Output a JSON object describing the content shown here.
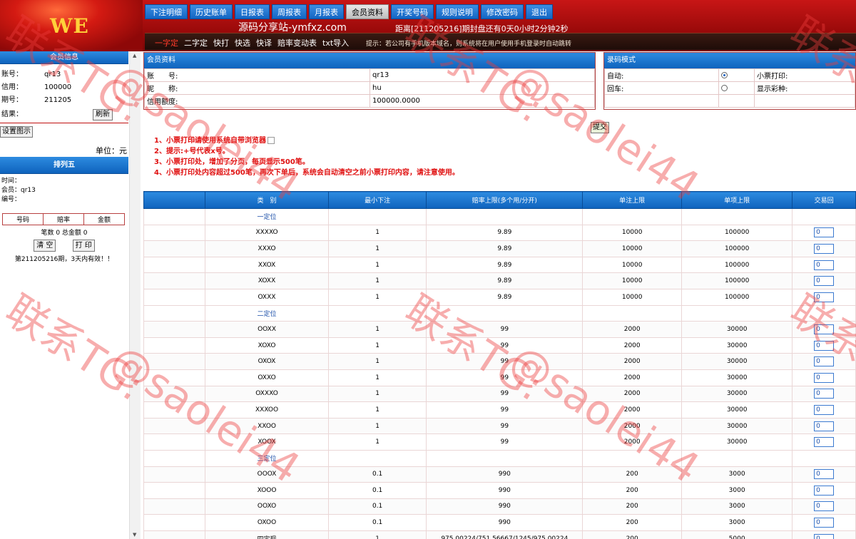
{
  "header": {
    "logo": "WE",
    "site_name": "源码分享站-ymfxz.com",
    "countdown": "距离[211205216]期封盘还有0天0小时2分钟2秒",
    "nav": [
      {
        "label": "下注明细",
        "active": false
      },
      {
        "label": "历史账单",
        "active": false
      },
      {
        "label": "日报表",
        "active": false
      },
      {
        "label": "周报表",
        "active": false
      },
      {
        "label": "月报表",
        "active": false
      },
      {
        "label": "会员资料",
        "active": true
      },
      {
        "label": "开奖号码",
        "active": false
      },
      {
        "label": "规则说明",
        "active": false
      },
      {
        "label": "修改密码",
        "active": false
      },
      {
        "label": "退出",
        "active": false
      }
    ],
    "subnav": [
      {
        "label": "一字定",
        "active": true
      },
      {
        "label": "二字定",
        "active": false
      },
      {
        "label": "快打",
        "active": false
      },
      {
        "label": "快选",
        "active": false
      },
      {
        "label": "快译",
        "active": false
      },
      {
        "label": "赔率变动表",
        "active": false
      },
      {
        "label": "txt导入",
        "active": false
      }
    ],
    "tip": "提示：若公司有手机版本域名，则系统将在用户使用手机登录时自动跳转"
  },
  "sidebar": {
    "member_title": "会员信息",
    "account_label": "账号：",
    "account": "qr13",
    "credit_label": "信用：",
    "credit": "100000",
    "period_label": "期号：",
    "period": "211205",
    "result_label": "结果：",
    "refresh": "刷新",
    "settings": "设置图示",
    "unit": "单位：元",
    "pl5_title": "排列五",
    "time_label": "时间：",
    "member_line": "会员：qr13",
    "number_label": "编号：",
    "slip_headers": [
      "号码",
      "赔率",
      "金额"
    ],
    "summary": "笔数 0 总金额 0",
    "clear": "清 空",
    "print": "打 印",
    "period_note": "第211205216期，3天内有效！！"
  },
  "member_panel": {
    "title": "会员资料",
    "rows": [
      {
        "label": "账　　号:",
        "value": "qr13"
      },
      {
        "label": "昵　　称:",
        "value": "hu"
      },
      {
        "label": "信用额度:",
        "value": "100000.0000"
      }
    ]
  },
  "mode_panel": {
    "title": "录码模式",
    "auto_label": "自动:",
    "return_label": "回车:",
    "print_label": "小票打印:",
    "show_label": "显示彩种:"
  },
  "submit": "提交",
  "notes": [
    "1、小票打印请使用系统自带浏览器",
    "2、提示:+号代表x号。",
    "3、小票打印处，增加了分页，每页显示500笔。",
    "4、小票打印处内容超过500笔，再次下单后，系统会自动清空之前小票打印内容，请注意使用。"
  ],
  "odds_table": {
    "headers": [
      "",
      "类　别",
      "最小下注",
      "赔率上限(多个用/分开)",
      "单注上限",
      "单项上限",
      "交易回"
    ],
    "groups": [
      {
        "name": "一定位",
        "rows": [
          {
            "code": "XXXXO",
            "min": "1",
            "odds": "9.89",
            "single": "10000",
            "item": "100000",
            "val": "0"
          },
          {
            "code": "XXXO",
            "min": "1",
            "odds": "9.89",
            "single": "10000",
            "item": "100000",
            "val": "0"
          },
          {
            "code": "XXOX",
            "min": "1",
            "odds": "9.89",
            "single": "10000",
            "item": "100000",
            "val": "0"
          },
          {
            "code": "XOXX",
            "min": "1",
            "odds": "9.89",
            "single": "10000",
            "item": "100000",
            "val": "0"
          },
          {
            "code": "OXXX",
            "min": "1",
            "odds": "9.89",
            "single": "10000",
            "item": "100000",
            "val": "0"
          }
        ]
      },
      {
        "name": "二定位",
        "rows": [
          {
            "code": "OOXX",
            "min": "1",
            "odds": "99",
            "single": "2000",
            "item": "30000",
            "val": "0"
          },
          {
            "code": "XOXO",
            "min": "1",
            "odds": "99",
            "single": "2000",
            "item": "30000",
            "val": "0"
          },
          {
            "code": "OXOX",
            "min": "1",
            "odds": "99",
            "single": "2000",
            "item": "30000",
            "val": "0"
          },
          {
            "code": "OXXO",
            "min": "1",
            "odds": "99",
            "single": "2000",
            "item": "30000",
            "val": "0"
          },
          {
            "code": "OXXXO",
            "min": "1",
            "odds": "99",
            "single": "2000",
            "item": "30000",
            "val": "0"
          },
          {
            "code": "XXXOO",
            "min": "1",
            "odds": "99",
            "single": "2000",
            "item": "30000",
            "val": "0"
          },
          {
            "code": "XXOO",
            "min": "1",
            "odds": "99",
            "single": "2000",
            "item": "30000",
            "val": "0"
          },
          {
            "code": "XOOX",
            "min": "1",
            "odds": "99",
            "single": "2000",
            "item": "30000",
            "val": "0"
          }
        ]
      },
      {
        "name": "三定位",
        "rows": [
          {
            "code": "OOOX",
            "min": "0.1",
            "odds": "990",
            "single": "200",
            "item": "3000",
            "val": "0"
          },
          {
            "code": "XOOO",
            "min": "0.1",
            "odds": "990",
            "single": "200",
            "item": "3000",
            "val": "0"
          },
          {
            "code": "OOXO",
            "min": "0.1",
            "odds": "990",
            "single": "200",
            "item": "3000",
            "val": "0"
          },
          {
            "code": "OXOO",
            "min": "0.1",
            "odds": "990",
            "single": "200",
            "item": "3000",
            "val": "0"
          },
          {
            "code": "四定现",
            "min": "1",
            "odds": "975.00224/751.56667/1245/975.00224",
            "single": "200",
            "item": "5000",
            "val": "0"
          }
        ]
      }
    ]
  },
  "watermark": [
    "联系TG:",
    "@saolei44"
  ]
}
